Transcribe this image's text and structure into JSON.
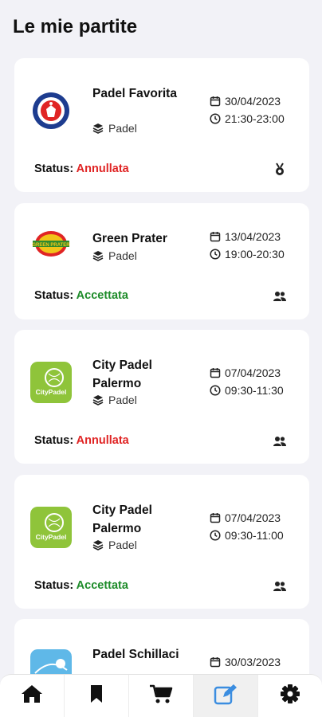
{
  "header": {
    "title": "Le mie partite"
  },
  "colors": {
    "cancelled": "#e02424",
    "accepted": "#1e8c2a",
    "active_nav": "#3b8de0"
  },
  "matches": [
    {
      "name": "Padel Favorita",
      "sport": "Padel",
      "date": "30/04/2023",
      "time": "21:30-23:00",
      "status_label": "Status:",
      "status": "Annullata",
      "status_icon": "medal-icon"
    },
    {
      "name": "Green Prater",
      "sport": "Padel",
      "date": "13/04/2023",
      "time": "19:00-20:30",
      "status_label": "Status:",
      "status": "Accettata",
      "status_icon": "users-icon"
    },
    {
      "name": "City Padel Palermo",
      "sport": "Padel",
      "date": "07/04/2023",
      "time": "09:30-11:30",
      "status_label": "Status:",
      "status": "Annullata",
      "status_icon": "users-icon"
    },
    {
      "name": "City Padel Palermo",
      "sport": "Padel",
      "date": "07/04/2023",
      "time": "09:30-11:00",
      "status_label": "Status:",
      "status": "Accettata",
      "status_icon": "users-icon"
    },
    {
      "name": "Padel Schillaci",
      "date": "30/03/2023"
    }
  ],
  "nav": [
    {
      "icon": "home-icon"
    },
    {
      "icon": "bookmark-icon"
    },
    {
      "icon": "cart-icon"
    },
    {
      "icon": "edit-icon",
      "active": true
    },
    {
      "icon": "settings-icon"
    }
  ]
}
